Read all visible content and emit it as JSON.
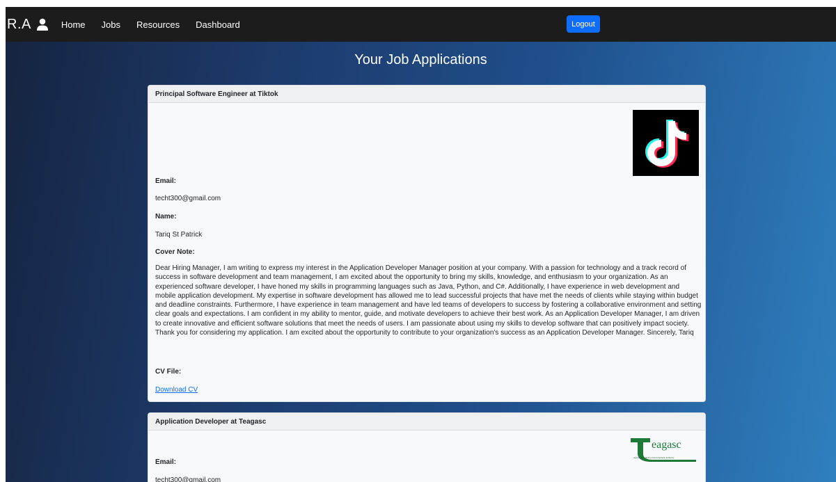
{
  "navbar": {
    "brand": "R.A",
    "links": [
      "Home",
      "Jobs",
      "Resources",
      "Dashboard"
    ],
    "logout_label": "Logout"
  },
  "page": {
    "title": "Your Job Applications"
  },
  "applications": [
    {
      "header": "Principal Software Engineer at Tiktok",
      "logo": "tiktok-logo",
      "email_label": "Email:",
      "email": "techt300@gmail.com",
      "name_label": "Name:",
      "name": "Tariq St Patrick",
      "cover_label": "Cover Note:",
      "cover_note": "Dear Hiring Manager, I am writing to express my interest in the Application Developer Manager position at your company. With a passion for technology and a track record of success in software development and team management, I am excited about the opportunity to bring my skills, knowledge, and enthusiasm to your organization. As an experienced software developer, I have honed my skills in programming languages such as Java, Python, and C#. Additionally, I have experience in web development and mobile application development. My expertise in software development has allowed me to lead successful projects that have met the needs of clients while staying within budget and deadline constraints. Furthermore, I have experience in team management and have led teams of developers to success by fostering a collaborative environment and setting clear goals and expectations. I am confident in my ability to mentor, guide, and motivate developers to achieve their best work. As an Application Developer Manager, I am driven to create innovative and efficient software solutions that meet the needs of users. I am passionate about using my skills to develop software that can positively impact society. Thank you for considering my application. I am excited about the opportunity to contribute to your organization's success as an Application Developer Manager. Sincerely, Tariq",
      "cv_label": "CV File:",
      "cv_link": "Download CV"
    },
    {
      "header": "Application Developer at Teagasc",
      "logo": "teagasc-logo",
      "logo_text": "eagasc",
      "logo_subtext": "Agriculture and Food Development Authority",
      "email_label": "Email:",
      "email": "techt300@gmail.com"
    }
  ],
  "colors": {
    "navbar": "#1c1c1c",
    "logout": "#0d6efd",
    "link": "#0d6efd",
    "card": "#f8f9fa",
    "tiktok_cyan": "#25f4ee",
    "tiktok_red": "#fe2c55",
    "teagasc_green": "#1f7a3a"
  }
}
